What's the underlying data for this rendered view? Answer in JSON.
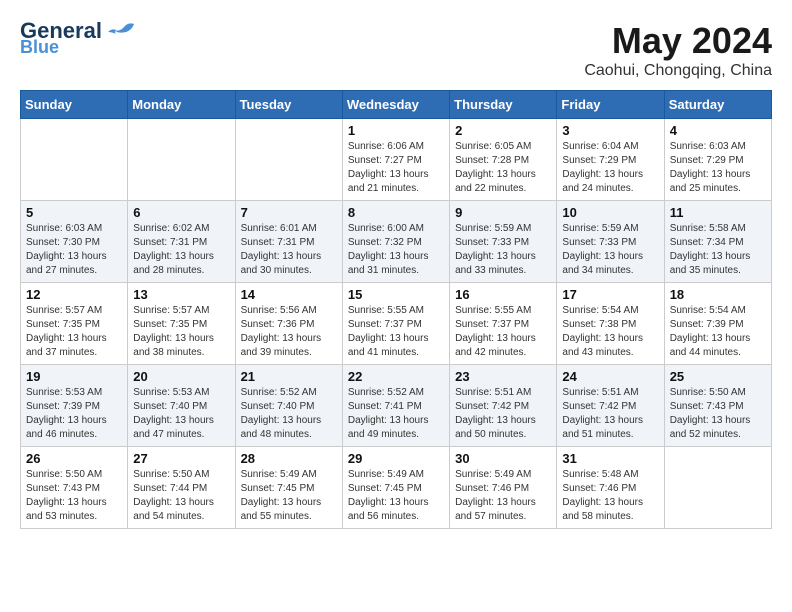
{
  "logo": {
    "line1": "General",
    "line2": "Blue"
  },
  "title": "May 2024",
  "subtitle": "Caohui, Chongqing, China",
  "weekdays": [
    "Sunday",
    "Monday",
    "Tuesday",
    "Wednesday",
    "Thursday",
    "Friday",
    "Saturday"
  ],
  "weeks": [
    [
      {
        "day": "",
        "info": ""
      },
      {
        "day": "",
        "info": ""
      },
      {
        "day": "",
        "info": ""
      },
      {
        "day": "1",
        "info": "Sunrise: 6:06 AM\nSunset: 7:27 PM\nDaylight: 13 hours\nand 21 minutes."
      },
      {
        "day": "2",
        "info": "Sunrise: 6:05 AM\nSunset: 7:28 PM\nDaylight: 13 hours\nand 22 minutes."
      },
      {
        "day": "3",
        "info": "Sunrise: 6:04 AM\nSunset: 7:29 PM\nDaylight: 13 hours\nand 24 minutes."
      },
      {
        "day": "4",
        "info": "Sunrise: 6:03 AM\nSunset: 7:29 PM\nDaylight: 13 hours\nand 25 minutes."
      }
    ],
    [
      {
        "day": "5",
        "info": "Sunrise: 6:03 AM\nSunset: 7:30 PM\nDaylight: 13 hours\nand 27 minutes."
      },
      {
        "day": "6",
        "info": "Sunrise: 6:02 AM\nSunset: 7:31 PM\nDaylight: 13 hours\nand 28 minutes."
      },
      {
        "day": "7",
        "info": "Sunrise: 6:01 AM\nSunset: 7:31 PM\nDaylight: 13 hours\nand 30 minutes."
      },
      {
        "day": "8",
        "info": "Sunrise: 6:00 AM\nSunset: 7:32 PM\nDaylight: 13 hours\nand 31 minutes."
      },
      {
        "day": "9",
        "info": "Sunrise: 5:59 AM\nSunset: 7:33 PM\nDaylight: 13 hours\nand 33 minutes."
      },
      {
        "day": "10",
        "info": "Sunrise: 5:59 AM\nSunset: 7:33 PM\nDaylight: 13 hours\nand 34 minutes."
      },
      {
        "day": "11",
        "info": "Sunrise: 5:58 AM\nSunset: 7:34 PM\nDaylight: 13 hours\nand 35 minutes."
      }
    ],
    [
      {
        "day": "12",
        "info": "Sunrise: 5:57 AM\nSunset: 7:35 PM\nDaylight: 13 hours\nand 37 minutes."
      },
      {
        "day": "13",
        "info": "Sunrise: 5:57 AM\nSunset: 7:35 PM\nDaylight: 13 hours\nand 38 minutes."
      },
      {
        "day": "14",
        "info": "Sunrise: 5:56 AM\nSunset: 7:36 PM\nDaylight: 13 hours\nand 39 minutes."
      },
      {
        "day": "15",
        "info": "Sunrise: 5:55 AM\nSunset: 7:37 PM\nDaylight: 13 hours\nand 41 minutes."
      },
      {
        "day": "16",
        "info": "Sunrise: 5:55 AM\nSunset: 7:37 PM\nDaylight: 13 hours\nand 42 minutes."
      },
      {
        "day": "17",
        "info": "Sunrise: 5:54 AM\nSunset: 7:38 PM\nDaylight: 13 hours\nand 43 minutes."
      },
      {
        "day": "18",
        "info": "Sunrise: 5:54 AM\nSunset: 7:39 PM\nDaylight: 13 hours\nand 44 minutes."
      }
    ],
    [
      {
        "day": "19",
        "info": "Sunrise: 5:53 AM\nSunset: 7:39 PM\nDaylight: 13 hours\nand 46 minutes."
      },
      {
        "day": "20",
        "info": "Sunrise: 5:53 AM\nSunset: 7:40 PM\nDaylight: 13 hours\nand 47 minutes."
      },
      {
        "day": "21",
        "info": "Sunrise: 5:52 AM\nSunset: 7:40 PM\nDaylight: 13 hours\nand 48 minutes."
      },
      {
        "day": "22",
        "info": "Sunrise: 5:52 AM\nSunset: 7:41 PM\nDaylight: 13 hours\nand 49 minutes."
      },
      {
        "day": "23",
        "info": "Sunrise: 5:51 AM\nSunset: 7:42 PM\nDaylight: 13 hours\nand 50 minutes."
      },
      {
        "day": "24",
        "info": "Sunrise: 5:51 AM\nSunset: 7:42 PM\nDaylight: 13 hours\nand 51 minutes."
      },
      {
        "day": "25",
        "info": "Sunrise: 5:50 AM\nSunset: 7:43 PM\nDaylight: 13 hours\nand 52 minutes."
      }
    ],
    [
      {
        "day": "26",
        "info": "Sunrise: 5:50 AM\nSunset: 7:43 PM\nDaylight: 13 hours\nand 53 minutes."
      },
      {
        "day": "27",
        "info": "Sunrise: 5:50 AM\nSunset: 7:44 PM\nDaylight: 13 hours\nand 54 minutes."
      },
      {
        "day": "28",
        "info": "Sunrise: 5:49 AM\nSunset: 7:45 PM\nDaylight: 13 hours\nand 55 minutes."
      },
      {
        "day": "29",
        "info": "Sunrise: 5:49 AM\nSunset: 7:45 PM\nDaylight: 13 hours\nand 56 minutes."
      },
      {
        "day": "30",
        "info": "Sunrise: 5:49 AM\nSunset: 7:46 PM\nDaylight: 13 hours\nand 57 minutes."
      },
      {
        "day": "31",
        "info": "Sunrise: 5:48 AM\nSunset: 7:46 PM\nDaylight: 13 hours\nand 58 minutes."
      },
      {
        "day": "",
        "info": ""
      }
    ]
  ]
}
